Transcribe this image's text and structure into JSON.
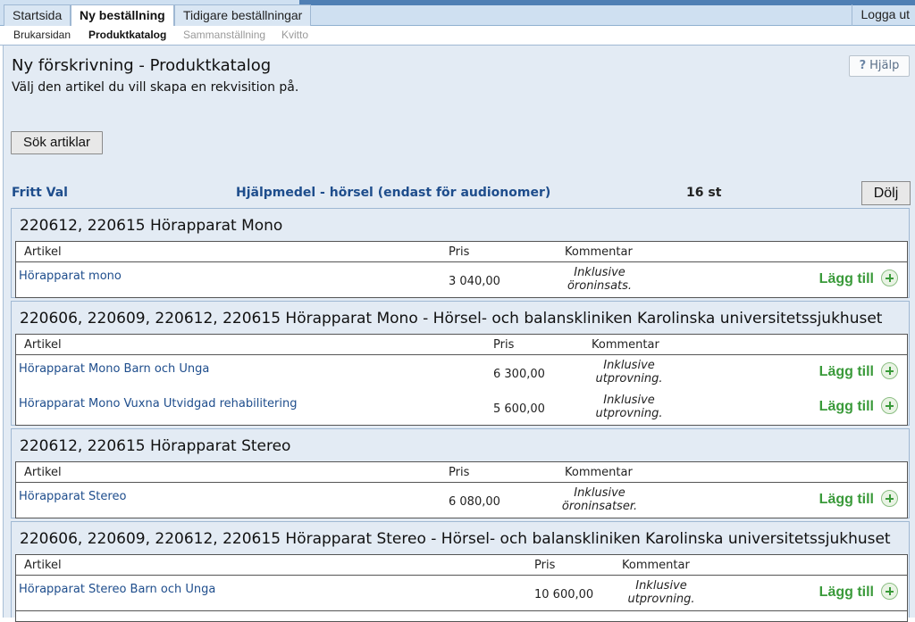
{
  "nav": {
    "tabs": [
      "Startsida",
      "Ny beställning",
      "Tidigare beställningar"
    ],
    "logout": "Logga ut"
  },
  "subnav": [
    "Brukarsidan",
    "Produktkatalog",
    "Sammanställning",
    "Kvitto"
  ],
  "page": {
    "title": "Ny förskrivning - Produktkatalog",
    "subtitle": "Välj den artikel du vill skapa en rekvisition på.",
    "help": "Hjälp",
    "search_button": "Sök artiklar"
  },
  "category": {
    "left": "Fritt Val",
    "name": "Hjälpmedel - hörsel (endast för audionomer)",
    "count": "16 st",
    "hide_button": "Dölj"
  },
  "columns": {
    "article": "Artikel",
    "price": "Pris",
    "comment": "Kommentar"
  },
  "add_label": "Lägg till",
  "groups": [
    {
      "title": "220612, 220615 Hörapparat Mono",
      "rows": [
        {
          "name": "Hörapparat mono",
          "price": "3 040,00",
          "comment1": "Inklusive",
          "comment2": "öroninsats."
        }
      ]
    },
    {
      "title": "220606, 220609, 220612, 220615 Hörapparat Mono - Hörsel- och balanskliniken Karolinska universitetssjukhuset",
      "rows": [
        {
          "name": "Hörapparat Mono Barn och Unga",
          "price": "6 300,00",
          "comment1": "Inklusive",
          "comment2": "utprovning."
        },
        {
          "name": "Hörapparat Mono Vuxna Utvidgad rehabilitering",
          "price": "5 600,00",
          "comment1": "Inklusive",
          "comment2": "utprovning."
        }
      ]
    },
    {
      "title": "220612, 220615 Hörapparat Stereo",
      "rows": [
        {
          "name": "Hörapparat Stereo",
          "price": "6 080,00",
          "comment1": "Inklusive",
          "comment2": "öroninsatser."
        }
      ]
    },
    {
      "title": "220606, 220609, 220612, 220615 Hörapparat Stereo - Hörsel- och balanskliniken Karolinska universitetssjukhuset",
      "rows": [
        {
          "name": "Hörapparat Stereo Barn och Unga",
          "price": "10 600,00",
          "comment1": "Inklusive",
          "comment2": "utprovning."
        }
      ]
    }
  ]
}
